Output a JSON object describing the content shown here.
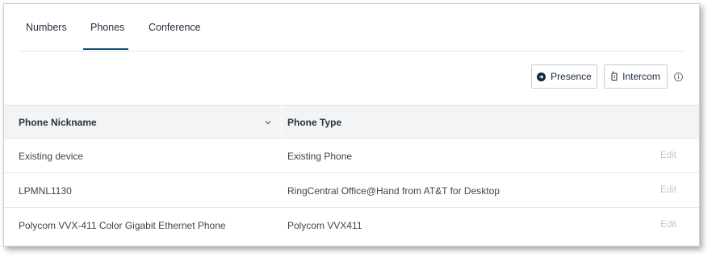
{
  "tabs": [
    {
      "label": "Numbers"
    },
    {
      "label": "Phones",
      "active": true
    },
    {
      "label": "Conference"
    }
  ],
  "toolbar": {
    "presence_label": "Presence",
    "intercom_label": "Intercom",
    "presence_icon": "arrow-circle-icon",
    "intercom_icon": "phone-handset-icon",
    "info_icon": "info-icon"
  },
  "table": {
    "headers": {
      "nickname": "Phone Nickname",
      "type": "Phone Type"
    },
    "rows": [
      {
        "nickname": "Existing device",
        "type": "Existing Phone",
        "action": "Edit"
      },
      {
        "nickname": "LPMNL1130",
        "type": "RingCentral Office@Hand from AT&T for Desktop",
        "action": "Edit"
      },
      {
        "nickname": "Polycom VVX-411 Color Gigabit Ethernet Phone",
        "type": "Polycom VVX411",
        "action": "Edit"
      }
    ]
  },
  "colors": {
    "accent": "#0a4b73",
    "header_bg": "#f3f4f6",
    "edit_disabled": "#c3c7cc"
  }
}
